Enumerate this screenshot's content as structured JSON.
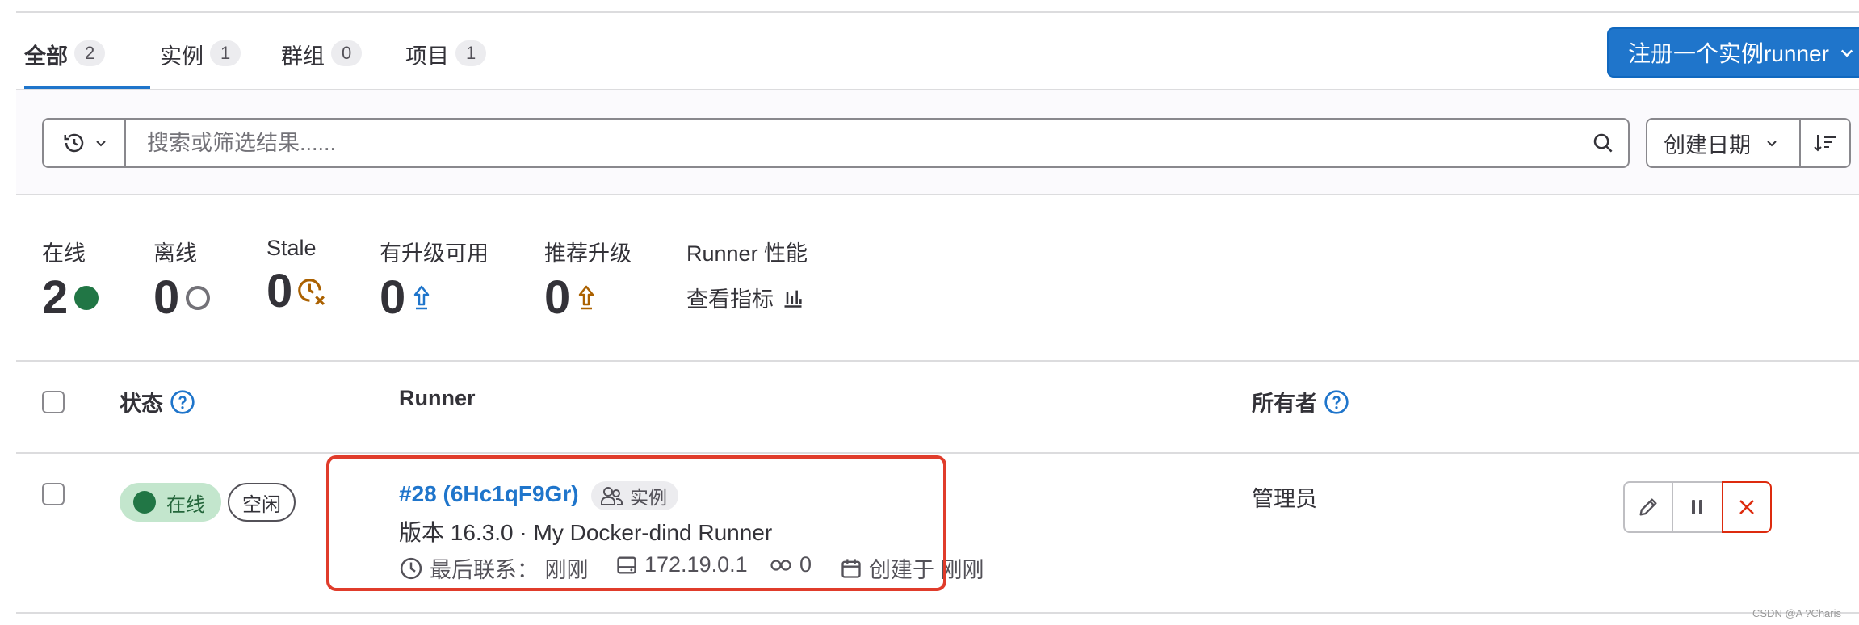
{
  "tabs": [
    {
      "label": "全部",
      "count": "2"
    },
    {
      "label": "实例",
      "count": "1"
    },
    {
      "label": "群组",
      "count": "0"
    },
    {
      "label": "项目",
      "count": "1"
    }
  ],
  "register_button": "注册一个实例runner",
  "search": {
    "placeholder": "搜索或筛选结果......"
  },
  "sort": {
    "label": "创建日期"
  },
  "stats": {
    "online": {
      "label": "在线",
      "value": "2"
    },
    "offline": {
      "label": "离线",
      "value": "0"
    },
    "stale": {
      "label": "Stale",
      "value": "0"
    },
    "upgrade_available": {
      "label": "有升级可用",
      "value": "0"
    },
    "upgrade_recommended": {
      "label": "推荐升级",
      "value": "0"
    },
    "performance": {
      "label": "Runner 性能",
      "link": "查看指标"
    }
  },
  "table": {
    "headers": {
      "status": "状态",
      "runner": "Runner",
      "owner": "所有者"
    },
    "rows": [
      {
        "status": "在线",
        "idle": "空闲",
        "id": "#28 (6Hc1qF9Gr)",
        "type": "实例",
        "description": "版本 16.3.0 · My Docker-dind Runner",
        "last_contact": "最后联系：  刚刚",
        "ip": "172.19.0.1",
        "jobs": "0",
        "created": "创建于 刚刚",
        "owner": "管理员"
      }
    ]
  },
  "watermark": "CSDN @A ?Charis",
  "colors": {
    "accent": "#1f75cb",
    "online": "#217645",
    "danger": "#dd2b0e",
    "warning": "#ab6100",
    "highlight": "#e03c2b"
  }
}
